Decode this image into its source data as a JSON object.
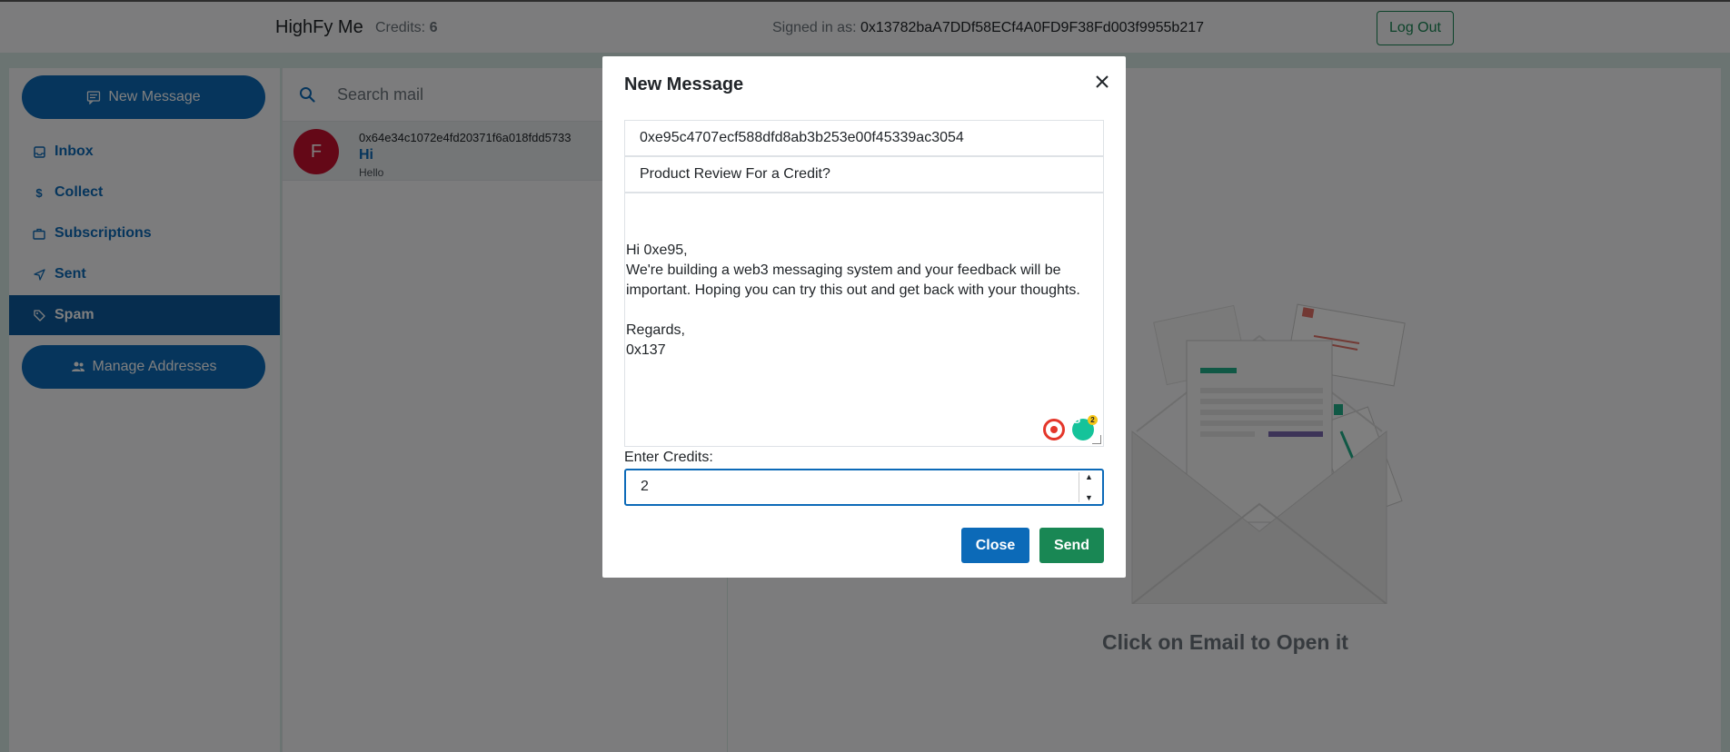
{
  "navbar": {
    "brand": "HighFy Me",
    "credits_label": "Credits:",
    "credits_value": "6",
    "signed_in_label": "Signed in as:",
    "signed_in_address": "0x13782baA7DDf58ECf4A0FD9F38Fd003f9955b217",
    "logout_label": "Log Out"
  },
  "sidebar": {
    "new_message_label": "New Message",
    "items": [
      {
        "label": "Inbox",
        "icon": "inbox-icon"
      },
      {
        "label": "Collect",
        "icon": "dollar-icon"
      },
      {
        "label": "Subscriptions",
        "icon": "briefcase-icon"
      },
      {
        "label": "Sent",
        "icon": "send-icon"
      },
      {
        "label": "Spam",
        "icon": "tag-icon",
        "active": true
      }
    ],
    "manage_addresses_label": "Manage Addresses"
  },
  "mail_list": {
    "search_placeholder": "Search mail",
    "items": [
      {
        "avatar": "F",
        "from": "0x64e34c1072e4fd20371f6a018fdd5733",
        "subject": "Hi",
        "preview": "Hello"
      }
    ]
  },
  "reader": {
    "empty_text": "Click on Email to Open it"
  },
  "modal": {
    "title": "New Message",
    "to": "0xe95c4707ecf588dfd8ab3b253e00f45339ac3054",
    "subject": "Product Review For a Credit?",
    "body": "Hi 0xe95,\nWe're building a web3 messaging system and your feedback will be\nimportant. Hoping you can try this out and get back with your thoughts.\n\nRegards,\n0x137",
    "grammarly_badge": "2",
    "credits_label": "Enter Credits:",
    "credits_value": "2",
    "close_label": "Close",
    "send_label": "Send"
  },
  "colors": {
    "primary": "#0c6ab8",
    "success": "#198754",
    "avatar": "#c8102e"
  }
}
